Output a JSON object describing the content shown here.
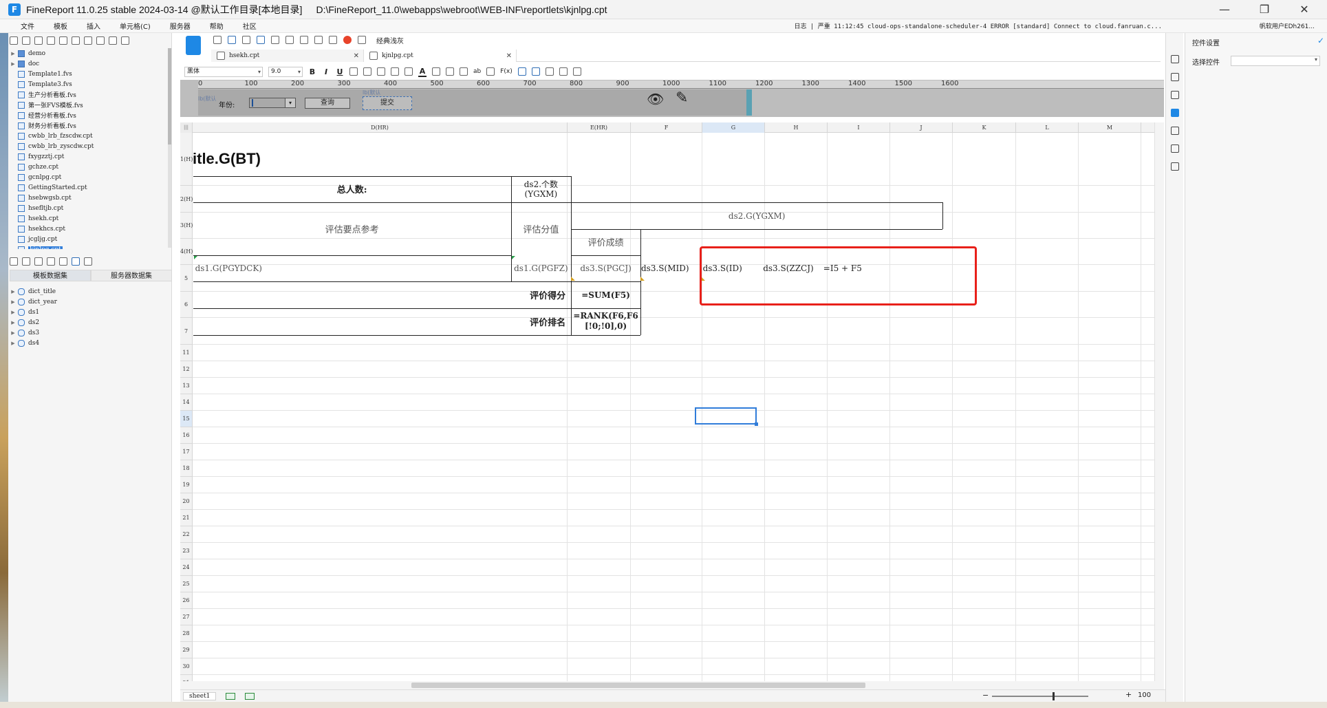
{
  "window": {
    "title": "FineReport 11.0.25 stable 2024-03-14 @默认工作目录[本地目录]",
    "path": "D:\\FineReport_11.0\\webapps\\webroot\\WEB-INF\\reportlets\\kjnlpg.cpt",
    "minimize": "—",
    "maximize": "❐",
    "close": "✕"
  },
  "menu": [
    "文件",
    "模板",
    "插入",
    "单元格(C)",
    "服务器",
    "帮助",
    "社区"
  ],
  "log": {
    "text": "日志 | 严重 11:12:45 cloud-ops-standalone-scheduler-4 ERROR [standard] Connect to cloud.fanruan.c...",
    "user": "帆软用户EDh261..."
  },
  "file_tree": [
    {
      "label": "demo",
      "folder": true
    },
    {
      "label": "doc",
      "folder": true
    },
    {
      "label": "Template1.fvs",
      "folder": false
    },
    {
      "label": "Template3.fvs",
      "folder": false
    },
    {
      "label": "生产分析看板.fvs",
      "folder": false
    },
    {
      "label": "第一张FVS模板.fvs",
      "folder": false
    },
    {
      "label": "经营分析看板.fvs",
      "folder": false
    },
    {
      "label": "财务分析看板.fvs",
      "folder": false
    },
    {
      "label": "cwbb_lrb_fzscdw.cpt",
      "folder": false
    },
    {
      "label": "cwbb_lrb_zyscdw.cpt",
      "folder": false
    },
    {
      "label": "fxygzztj.cpt",
      "folder": false
    },
    {
      "label": "gchze.cpt",
      "folder": false
    },
    {
      "label": "gcnlpg.cpt",
      "folder": false
    },
    {
      "label": "GettingStarted.cpt",
      "folder": false
    },
    {
      "label": "hsebwgsb.cpt",
      "folder": false
    },
    {
      "label": "hsefltjb.cpt",
      "folder": false
    },
    {
      "label": "hsekh.cpt",
      "folder": false
    },
    {
      "label": "hsekhcs.cpt",
      "folder": false
    },
    {
      "label": "jcgljg.cpt",
      "folder": false
    },
    {
      "label": "kjnlpg.cpt",
      "folder": false,
      "selected": true
    }
  ],
  "ds_tabs": [
    "模板数据集",
    "服务器数据集"
  ],
  "datasets": [
    "dict_title",
    "dict_year",
    "ds1",
    "ds2",
    "ds3",
    "ds4"
  ],
  "editor": {
    "style_label": "经典浅灰",
    "tabs": [
      {
        "label": "hsekh.cpt",
        "close": "✕"
      },
      {
        "label": "kjnlpg.cpt",
        "close": "✕"
      }
    ],
    "font": "黑体",
    "font_size": "9.0",
    "bold": "B",
    "italic": "I",
    "underline": "U",
    "fx": "F(x)",
    "ab": "ab",
    "fontcolor": "A"
  },
  "param": {
    "ruler": [
      "0",
      "100",
      "200",
      "300",
      "400",
      "500",
      "600",
      "700",
      "800",
      "900",
      "1000",
      "1100",
      "1200",
      "1300",
      "1400",
      "1500",
      "1600"
    ],
    "tag1": "lb(默认",
    "tag2": "lb(默认",
    "year_label": "年份:",
    "query": "查询",
    "submit": "提交",
    "hide_icon": "👁",
    "edit_icon": "✎"
  },
  "settings": {
    "title": "控件设置",
    "select_label": "选择控件",
    "check": "✓"
  },
  "grid": {
    "corner": "|||",
    "columns": [
      {
        "label": "D(HR)"
      },
      {
        "label": "E(HR)"
      },
      {
        "label": "F"
      },
      {
        "label": "G",
        "selected": true
      },
      {
        "label": "H"
      },
      {
        "label": "I"
      },
      {
        "label": "J"
      },
      {
        "label": "K"
      },
      {
        "label": "L"
      },
      {
        "label": "M"
      }
    ],
    "rows": [
      "1(H)",
      "2(H)",
      "3(H)",
      "4(H)",
      "5",
      "6",
      "7",
      "11",
      "12",
      "13",
      "14",
      "15",
      "16",
      "17",
      "18",
      "19",
      "20",
      "21",
      "22",
      "23",
      "24",
      "25",
      "26",
      "27",
      "28",
      "29",
      "30",
      "31"
    ],
    "selected_row": "15",
    "title_cell": "itle.G(BT)",
    "total_label": "总人数:",
    "count_cell": "ds2.个数(YGXM)",
    "ref_label": "评估要点参考",
    "score_label": "评估分值",
    "ygxm_cell": "ds2.G(YGXM)",
    "grade_label": "评价成绩",
    "pgydck": "ds1.G(PGYDCK)",
    "pgfz": "ds1.G(PGFZ)",
    "pgcj": "ds3.S(PGCJ)",
    "mid": "ds3.S(MID)",
    "id": "ds3.S(ID)",
    "zzcj": "ds3.S(ZZCJ)",
    "formula_i5": "=I5 + F5",
    "score_row_label": "评价得分",
    "sum_formula": "=SUM(F5)",
    "rank_row_label": "评价排名",
    "rank_formula": "=RANK(F6,F6[!0;!0],0)"
  },
  "status": {
    "sheet": "sheet1",
    "zoom": "100",
    "minus": "−",
    "plus": "+"
  }
}
